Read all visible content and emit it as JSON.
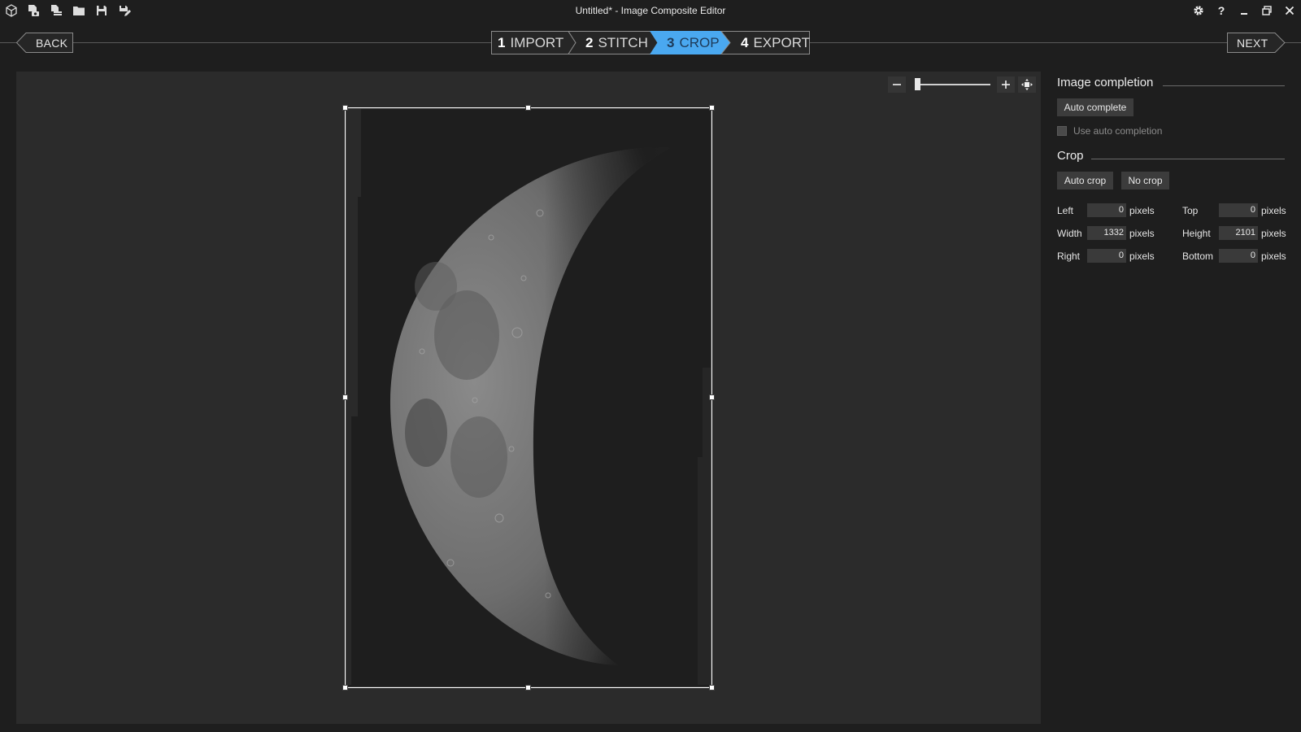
{
  "window": {
    "title": "Untitled* - Image Composite Editor",
    "quick_access_icons": [
      "app-logo-icon",
      "new-panorama-icon",
      "new-stitch-icon",
      "open-icon",
      "save-icon",
      "save-as-icon"
    ],
    "controls": [
      "settings-icon",
      "help-icon",
      "minimize-icon",
      "maximize-icon",
      "close-icon"
    ]
  },
  "wizard": {
    "back_label": "BACK",
    "next_label": "NEXT",
    "steps": [
      {
        "number": "1",
        "label": "IMPORT",
        "active": false
      },
      {
        "number": "2",
        "label": "STITCH",
        "active": false
      },
      {
        "number": "3",
        "label": "CROP",
        "active": true
      },
      {
        "number": "4",
        "label": "EXPORT",
        "active": false
      }
    ],
    "active_color": "#4aa8f0"
  },
  "zoom": {
    "minus_icon": "zoom-out-icon",
    "plus_icon": "zoom-in-icon",
    "fit_icon": "fit-to-window-icon",
    "level": 0
  },
  "image_completion": {
    "title": "Image completion",
    "auto_complete_label": "Auto complete",
    "use_auto_completion_label": "Use auto completion",
    "use_auto_completion_checked": false
  },
  "crop": {
    "title": "Crop",
    "auto_crop_label": "Auto crop",
    "no_crop_label": "No crop",
    "unit": "pixels",
    "fields": {
      "left": {
        "label": "Left",
        "value": "0"
      },
      "top": {
        "label": "Top",
        "value": "0"
      },
      "width": {
        "label": "Width",
        "value": "1332"
      },
      "height": {
        "label": "Height",
        "value": "2101"
      },
      "right": {
        "label": "Right",
        "value": "0"
      },
      "bottom": {
        "label": "Bottom",
        "value": "0"
      }
    }
  },
  "colors": {
    "background": "#1e1e1e",
    "canvas": "#2b2b2b",
    "accent": "#4aa8f0"
  }
}
